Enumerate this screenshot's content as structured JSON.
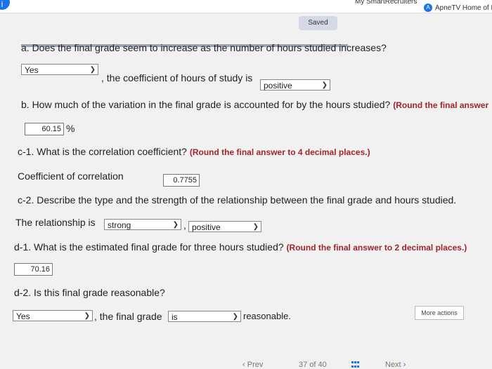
{
  "browser": {
    "bookmark_1": "My SmartRecruiters",
    "bookmark_2": "ApneTV Home of H",
    "bookmark_2_icon": "A"
  },
  "status": {
    "saved": "Saved"
  },
  "part_a": {
    "question": "a. Does the final grade seem to increase as the number of hours studied increases?",
    "select_1": "Yes",
    "middle_text": ", the coefficient of hours of study is",
    "select_2": "positive"
  },
  "part_b": {
    "question": "b. How much of the variation in the final grade is accounted for by the hours studied?",
    "round_note": "(Round the final answer",
    "answer": "60.15",
    "unit": "%"
  },
  "part_c1": {
    "question": "c-1. What is the correlation coefficient?",
    "round_note": "(Round the final answer to 4 decimal places.)",
    "label": "Coefficient of correlation",
    "answer": "0.7755"
  },
  "part_c2": {
    "question": "c-2. Describe the type and the strength of the relationship between the final grade and hours studied.",
    "label": "The relationship is",
    "select_1": "strong",
    "comma": ",",
    "select_2": "positive"
  },
  "part_d1": {
    "question": "d-1. What is the estimated final grade for three hours studied?",
    "round_note": "(Round the final answer to 2 decimal places.)",
    "answer": "70.16"
  },
  "part_d2": {
    "question": "d-2. Is this final grade reasonable?",
    "select_1": "Yes",
    "middle_text": ", the final grade",
    "select_2": "is",
    "end_text": "reasonable."
  },
  "more_actions": "More actions",
  "footer": {
    "prev": "Prev",
    "page": "37 of 40",
    "next": "Next"
  }
}
